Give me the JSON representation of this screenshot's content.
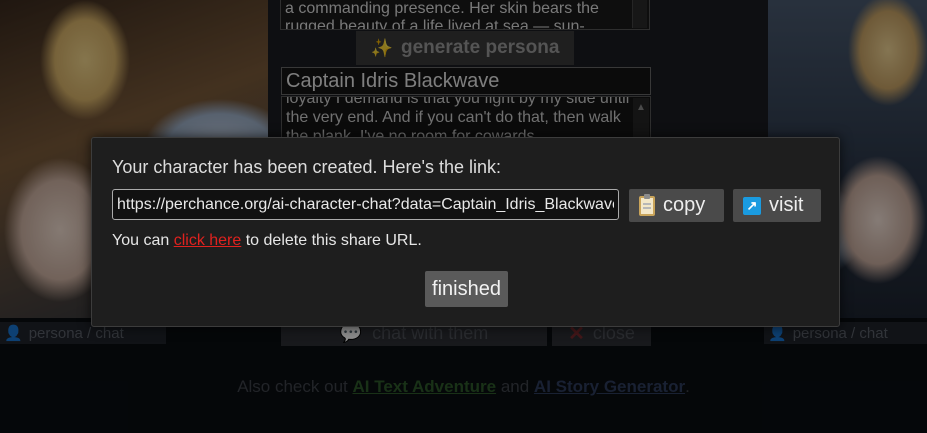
{
  "background": {
    "description_text": "a commanding presence. Her skin bears the rugged beauty of a life lived at sea — sun-",
    "generate_button_label": "generate persona",
    "character_name": "Captain Idris Blackwave",
    "bio_text": "loyalty I demand is that you fight by my side until the very end. And if you can't do that, then walk the plank. I've no room for cowards",
    "left_tag": "persona / chat",
    "right_tag": "persona / chat",
    "chat_button_label": "chat with them",
    "close_button_label": "close",
    "footer": {
      "prefix": "Also check out",
      "link1": "AI Text Adventure",
      "middle": "and",
      "link2": "AI Story Generator",
      "suffix": "."
    }
  },
  "modal": {
    "message": "Your character has been created. Here's the link:",
    "link_value": "https://perchance.org/ai-character-chat?data=Captain_Idris_Blackwave",
    "copy_label": "copy",
    "visit_label": "visit",
    "delete_prefix": "You can",
    "delete_link": "click here",
    "delete_suffix": "to delete this share URL.",
    "finished_label": "finished"
  },
  "colors": {
    "accent_link_red": "#e0221f",
    "visit_icon_blue": "#1a9be0",
    "footer_link_green": "#2e5a2a",
    "footer_link_blue": "#2f3c5e"
  },
  "icons": {
    "generate": "sparkles-icon",
    "copy": "clipboard-icon",
    "visit": "external-link-icon",
    "chat": "speech-bubble-icon",
    "close": "close-x-icon"
  }
}
